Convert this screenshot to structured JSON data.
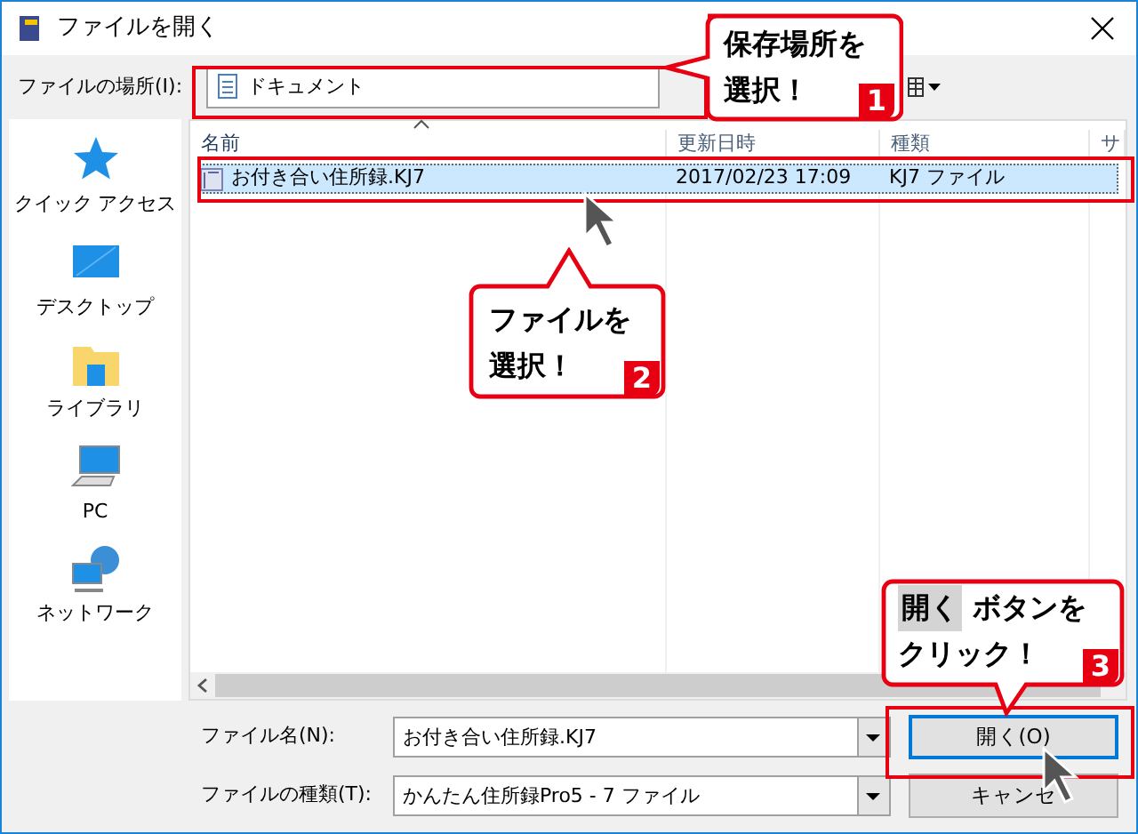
{
  "window": {
    "title": "ファイルを開く"
  },
  "location": {
    "label": "ファイルの場所(I):",
    "value": "ドキュメント"
  },
  "sidebar": {
    "items": [
      {
        "label": "クイック アクセス",
        "kind": "star"
      },
      {
        "label": "デスクトップ",
        "kind": "desktop"
      },
      {
        "label": "ライブラリ",
        "kind": "library"
      },
      {
        "label": "PC",
        "kind": "pc"
      },
      {
        "label": "ネットワーク",
        "kind": "network"
      }
    ]
  },
  "file_list": {
    "columns": [
      {
        "label": "名前",
        "sorted": true
      },
      {
        "label": "更新日時",
        "sorted": false
      },
      {
        "label": "種類",
        "sorted": false
      },
      {
        "label": "サ",
        "sorted": false
      }
    ],
    "rows": [
      {
        "name": "お付き合い住所録.KJ7",
        "date": "2017/02/23 17:09",
        "type": "KJ7 ファイル",
        "selected": true
      }
    ]
  },
  "file_name": {
    "label": "ファイル名(N):",
    "value": "お付き合い住所録.KJ7"
  },
  "file_type": {
    "label": "ファイルの種類(T):",
    "value": "かんたん住所録Pro5 - 7 ファイル"
  },
  "buttons": [
    "開く(O)",
    "キャンセ"
  ],
  "callouts": [
    {
      "number": "1",
      "lines": [
        "保存場所を",
        "選択！"
      ]
    },
    {
      "number": "2",
      "lines": [
        "ファイルを",
        "選択！"
      ]
    },
    {
      "number": "3",
      "highlight": "開く",
      "lines": [
        "ボタンを",
        "クリック！"
      ]
    }
  ]
}
